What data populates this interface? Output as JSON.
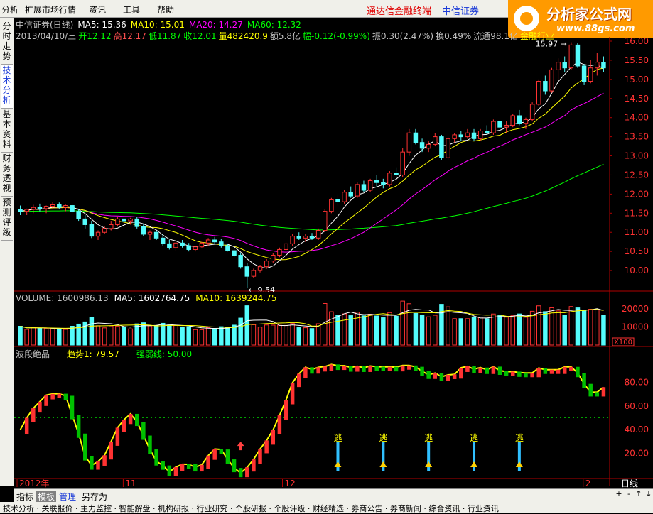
{
  "menubar": {
    "items": [
      "分析",
      "扩展市场行情",
      "资讯",
      "工具",
      "帮助"
    ],
    "brand_red": "通达信金融终端",
    "brand_blue": "中信证券"
  },
  "logo": {
    "title": "分析家公式网",
    "url": "www.88gs.com"
  },
  "sidebar": {
    "tabs": [
      {
        "label": "分时走势",
        "active": false
      },
      {
        "label": "技术分析",
        "active": true
      },
      {
        "label": "基本资料",
        "active": false
      },
      {
        "label": "财务透视",
        "active": false
      },
      {
        "label": "预测评级",
        "active": false
      }
    ]
  },
  "header": {
    "line1": [
      {
        "text": "中信证券(日线)",
        "color": "#c0c0c0"
      },
      {
        "text": "MA5: 15.36",
        "color": "#ffffff"
      },
      {
        "text": "MA10: 15.01",
        "color": "#ffff00"
      },
      {
        "text": "MA20: 14.27",
        "color": "#ff00ff"
      },
      {
        "text": "MA60: 12.32",
        "color": "#00ff00"
      }
    ],
    "line2": [
      {
        "text": "2013/04/10/三",
        "color": "#c0c0c0"
      },
      {
        "text": "开12.12",
        "color": "#00ff00"
      },
      {
        "text": "高12.17",
        "color": "#ff5050"
      },
      {
        "text": "低11.87",
        "color": "#00ff00"
      },
      {
        "text": "收12.01",
        "color": "#00ff00"
      },
      {
        "text": "量482420.9",
        "color": "#ffff00"
      },
      {
        "text": "额5.8亿",
        "color": "#c0c0c0"
      },
      {
        "text": "幅-0.12(-0.99%)",
        "color": "#00ff00"
      },
      {
        "text": "振0.30(2.47%)",
        "color": "#c0c0c0"
      },
      {
        "text": "换0.49%",
        "color": "#c0c0c0"
      },
      {
        "text": "流通98.1亿",
        "color": "#c0c0c0"
      },
      {
        "text": "金融行业",
        "color": "#ffff00"
      }
    ]
  },
  "volume_header": [
    {
      "text": "VOLUME: 1600986.13",
      "color": "#c0c0c0"
    },
    {
      "text": "MA5: 1602764.75",
      "color": "#ffffff"
    },
    {
      "text": "MA10: 1639244.75",
      "color": "#ffff00"
    }
  ],
  "indicator_header": [
    {
      "text": "波段绝品",
      "color": "#c0c0c0"
    },
    {
      "text": "趋势1: 79.57",
      "color": "#ffff00"
    },
    {
      "text": "强弱线: 50.00",
      "color": "#00ff00"
    }
  ],
  "colors": {
    "up": "#ff3232",
    "down": "#54fcfc",
    "ma5": "#ffffff",
    "ma10": "#ffff00",
    "ma20": "#ff00ff",
    "ma60": "#00ff00",
    "axis": "#b00000",
    "grid_text": "#ff3232"
  },
  "chart_data": [
    {
      "type": "candlestick",
      "title": "中信证券(日线)",
      "yticks": [
        10.0,
        10.5,
        11.0,
        11.5,
        12.0,
        12.5,
        13.0,
        13.5,
        14.0,
        14.5,
        15.0,
        15.5,
        16.0
      ],
      "ylim": [
        9.5,
        16.0
      ],
      "annotations": [
        {
          "label": "15.97"
        },
        {
          "label": "9.54"
        }
      ],
      "x_labels": [
        "2012年",
        "11",
        "12",
        "2"
      ],
      "ohlc": [
        [
          11.6,
          11.7,
          11.45,
          11.55
        ],
        [
          11.55,
          11.62,
          11.45,
          11.6
        ],
        [
          11.6,
          11.72,
          11.5,
          11.65
        ],
        [
          11.65,
          11.75,
          11.55,
          11.62
        ],
        [
          11.62,
          11.7,
          11.5,
          11.68
        ],
        [
          11.68,
          11.8,
          11.6,
          11.72
        ],
        [
          11.72,
          11.78,
          11.6,
          11.65
        ],
        [
          11.65,
          11.72,
          11.55,
          11.7
        ],
        [
          11.7,
          11.75,
          11.5,
          11.55
        ],
        [
          11.55,
          11.6,
          11.3,
          11.35
        ],
        [
          11.35,
          11.45,
          11.1,
          11.2
        ],
        [
          11.2,
          11.3,
          10.85,
          10.9
        ],
        [
          10.9,
          11.05,
          10.8,
          11.0
        ],
        [
          11.0,
          11.15,
          10.95,
          11.1
        ],
        [
          11.1,
          11.3,
          11.05,
          11.2
        ],
        [
          11.2,
          11.4,
          11.15,
          11.35
        ],
        [
          11.35,
          11.42,
          11.2,
          11.3
        ],
        [
          11.3,
          11.38,
          11.2,
          11.35
        ],
        [
          11.35,
          11.4,
          11.1,
          11.15
        ],
        [
          11.15,
          11.22,
          10.9,
          10.95
        ],
        [
          10.95,
          11.05,
          10.8,
          11.0
        ],
        [
          11.0,
          11.05,
          10.8,
          10.85
        ],
        [
          10.85,
          10.95,
          10.65,
          10.7
        ],
        [
          10.7,
          10.8,
          10.55,
          10.6
        ],
        [
          10.6,
          10.75,
          10.5,
          10.72
        ],
        [
          10.72,
          10.8,
          10.6,
          10.65
        ],
        [
          10.65,
          10.72,
          10.5,
          10.55
        ],
        [
          10.55,
          10.65,
          10.5,
          10.62
        ],
        [
          10.62,
          10.75,
          10.6,
          10.72
        ],
        [
          10.72,
          10.85,
          10.65,
          10.8
        ],
        [
          10.8,
          10.88,
          10.7,
          10.75
        ],
        [
          10.75,
          10.82,
          10.6,
          10.65
        ],
        [
          10.65,
          10.7,
          10.5,
          10.52
        ],
        [
          10.52,
          10.6,
          10.35,
          10.4
        ],
        [
          10.4,
          10.45,
          10.05,
          10.1
        ],
        [
          10.1,
          10.2,
          9.54,
          9.85
        ],
        [
          9.85,
          10.05,
          9.8,
          10.0
        ],
        [
          10.0,
          10.15,
          9.95,
          10.1
        ],
        [
          10.1,
          10.3,
          10.05,
          10.25
        ],
        [
          10.25,
          10.45,
          10.2,
          10.4
        ],
        [
          10.4,
          10.6,
          10.35,
          10.55
        ],
        [
          10.55,
          10.75,
          10.5,
          10.7
        ],
        [
          10.7,
          10.95,
          10.65,
          10.9
        ],
        [
          10.9,
          11.0,
          10.8,
          10.85
        ],
        [
          10.85,
          10.95,
          10.75,
          10.9
        ],
        [
          10.9,
          10.98,
          10.8,
          10.85
        ],
        [
          10.85,
          11.1,
          10.8,
          11.05
        ],
        [
          11.05,
          11.6,
          11.0,
          11.55
        ],
        [
          11.55,
          11.9,
          11.5,
          11.85
        ],
        [
          11.85,
          12.0,
          11.7,
          11.8
        ],
        [
          11.8,
          12.1,
          11.75,
          12.05
        ],
        [
          12.05,
          12.2,
          11.9,
          11.95
        ],
        [
          11.95,
          12.3,
          11.9,
          12.25
        ],
        [
          12.25,
          12.35,
          12.05,
          12.1
        ],
        [
          12.1,
          12.4,
          12.05,
          12.35
        ],
        [
          12.35,
          12.5,
          12.2,
          12.3
        ],
        [
          12.3,
          12.4,
          12.15,
          12.25
        ],
        [
          12.25,
          12.6,
          12.2,
          12.55
        ],
        [
          12.55,
          12.7,
          12.4,
          12.5
        ],
        [
          12.5,
          13.2,
          12.45,
          13.1
        ],
        [
          13.1,
          13.7,
          13.0,
          13.6
        ],
        [
          13.6,
          13.7,
          13.3,
          13.35
        ],
        [
          13.35,
          13.45,
          13.1,
          13.2
        ],
        [
          13.2,
          13.4,
          13.1,
          13.3
        ],
        [
          13.3,
          13.6,
          13.25,
          13.5
        ],
        [
          13.5,
          13.55,
          12.9,
          12.95
        ],
        [
          12.95,
          13.5,
          12.9,
          13.45
        ],
        [
          13.45,
          13.6,
          13.35,
          13.55
        ],
        [
          13.55,
          13.65,
          13.4,
          13.5
        ],
        [
          13.5,
          13.7,
          13.45,
          13.6
        ],
        [
          13.6,
          13.7,
          13.4,
          13.45
        ],
        [
          13.45,
          13.7,
          13.4,
          13.65
        ],
        [
          13.65,
          13.8,
          13.55,
          13.6
        ],
        [
          13.6,
          13.95,
          13.55,
          13.9
        ],
        [
          13.9,
          14.05,
          13.7,
          13.75
        ],
        [
          13.75,
          13.9,
          13.6,
          13.8
        ],
        [
          13.8,
          14.1,
          13.75,
          14.05
        ],
        [
          14.05,
          14.2,
          13.8,
          13.85
        ],
        [
          13.85,
          14.0,
          13.7,
          13.95
        ],
        [
          13.95,
          14.4,
          13.9,
          14.35
        ],
        [
          14.35,
          15.0,
          14.3,
          14.95
        ],
        [
          14.95,
          15.1,
          14.6,
          14.7
        ],
        [
          14.7,
          15.3,
          14.65,
          15.25
        ],
        [
          15.25,
          15.55,
          15.0,
          15.45
        ],
        [
          15.45,
          15.6,
          15.2,
          15.3
        ],
        [
          15.3,
          15.97,
          15.25,
          15.9
        ],
        [
          15.9,
          15.95,
          15.3,
          15.35
        ],
        [
          15.35,
          15.4,
          14.85,
          14.95
        ],
        [
          14.95,
          15.5,
          14.9,
          15.3
        ],
        [
          15.3,
          15.7,
          15.1,
          15.45
        ],
        [
          15.45,
          15.6,
          15.2,
          15.3
        ]
      ]
    },
    {
      "type": "bar",
      "title": "VOLUME",
      "yticks": [
        10000,
        20000
      ],
      "scale_label": "X100",
      "ylim": [
        0,
        22000
      ]
    },
    {
      "type": "line",
      "title": "波段绝品",
      "series_names": [
        "趋势1",
        "强弱线"
      ],
      "yticks": [
        20.0,
        40.0,
        60.0,
        80.0
      ],
      "ylim": [
        0,
        100
      ],
      "threshold": 50,
      "signals": {
        "buy_label": "",
        "sell_label": "逃"
      }
    }
  ],
  "bottombar": {
    "items": [
      {
        "label": "指标",
        "active": false
      },
      {
        "label": "模板",
        "active": true
      },
      {
        "label": "管理",
        "active": false
      },
      {
        "label": "另存为",
        "active": false
      }
    ],
    "period": "日线"
  },
  "strip_text": "技术分析 · 关联报价 · 主力监控 · 智能解盘 · 机构研报 · 行业研究 · 个股研报 · 个股评级 · 财经精选 · 券商公告 · 券商新闻 · 综合资讯 · 行业资讯"
}
